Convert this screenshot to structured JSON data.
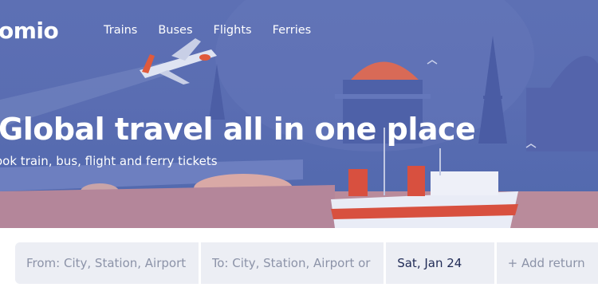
{
  "brand": {
    "logo_text": "omio"
  },
  "nav": {
    "items": [
      "Trains",
      "Buses",
      "Flights",
      "Ferries"
    ]
  },
  "hero": {
    "headline": "Global travel all in one place",
    "subline": "ook train, bus, flight and ferry tickets"
  },
  "search": {
    "from_placeholder": "From: City, Station, Airport",
    "to_placeholder": "To: City, Station, Airport or",
    "date_value": "Sat, Jan 24",
    "return_label": "+ Add return"
  },
  "colors": {
    "hero_background": "#5a6db2",
    "search_field": "#eceef4",
    "text_dark": "#1f2a55",
    "placeholder": "#8c93a8"
  }
}
